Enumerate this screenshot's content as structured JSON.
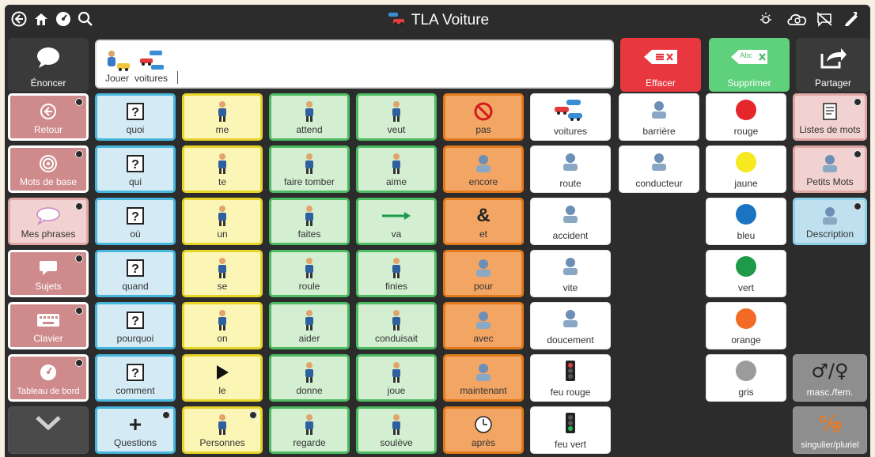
{
  "title": "TLA Voiture",
  "message": {
    "words": [
      "Jouer",
      "voitures"
    ]
  },
  "buttons": {
    "speak": "Énoncer",
    "clear": "Effacer",
    "delete": "Supprimer",
    "delete_tag": "Abc",
    "share": "Partager"
  },
  "nav": [
    "Retour",
    "Mots de base",
    "Mes phrases",
    "Sujets",
    "Clavier",
    "Tableau de bord"
  ],
  "col_blue": [
    "quoi",
    "qui",
    "où",
    "quand",
    "pourquoi",
    "comment",
    "Questions"
  ],
  "col_yellow": [
    "me",
    "te",
    "un",
    "se",
    "on",
    "le",
    "Personnes"
  ],
  "col_green": [
    "attend",
    "faire tomber",
    "faites",
    "roule",
    "aider",
    "donne",
    "regarde"
  ],
  "col_green2": [
    "veut",
    "aime",
    "va",
    "finies",
    "conduisait",
    "joue",
    "soulève"
  ],
  "col_orange": [
    "pas",
    "encore",
    "et",
    "pour",
    "avec",
    "maintenant",
    "après"
  ],
  "col_orange_glyphs": {
    "et": "&"
  },
  "col_white1": [
    "voitures",
    "route",
    "accident",
    "vite",
    "doucement",
    "feu rouge",
    "feu vert"
  ],
  "col_white2": [
    "barrière",
    "conducteur"
  ],
  "colors": [
    {
      "label": "rouge",
      "hex": "#e5262a"
    },
    {
      "label": "jaune",
      "hex": "#f7e81f"
    },
    {
      "label": "bleu",
      "hex": "#1b74c2"
    },
    {
      "label": "vert",
      "hex": "#1e9a4a"
    },
    {
      "label": "orange",
      "hex": "#f26a26"
    },
    {
      "label": "gris",
      "hex": "#9b9b9b"
    }
  ],
  "right_col": [
    "Listes de mots",
    "Petits Mots",
    "Description"
  ],
  "gray_col": {
    "gender": "masc./fem.",
    "gender_glyph": "♂/♀",
    "number": "singulier/pluriel"
  }
}
